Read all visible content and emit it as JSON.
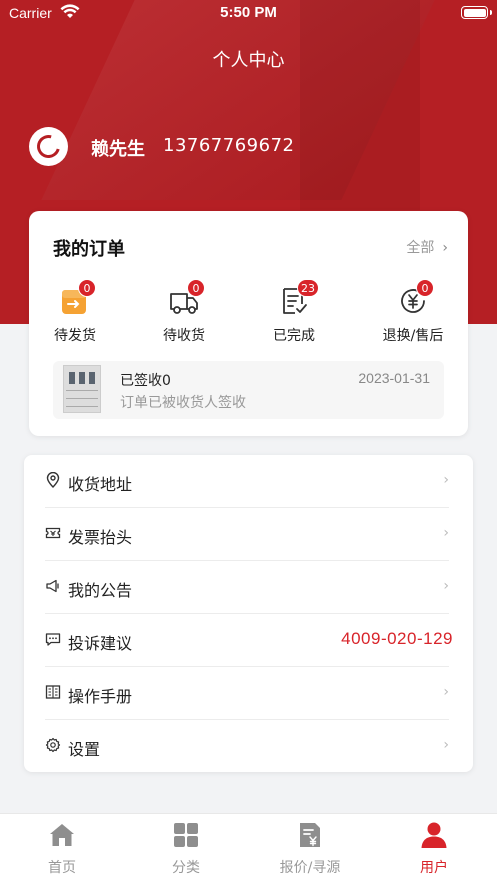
{
  "status_bar": {
    "carrier": "Carrier",
    "time": "5:50 PM"
  },
  "header": {
    "title": "个人中心"
  },
  "user": {
    "name": "赖先生",
    "phone": "13767769672"
  },
  "orders": {
    "title": "我的订单",
    "all_label": "全部",
    "statuses": [
      {
        "label": "待发货",
        "count": "0",
        "icon": "box-arrow-icon"
      },
      {
        "label": "待收货",
        "count": "0",
        "icon": "truck-icon"
      },
      {
        "label": "已完成",
        "count": "23",
        "icon": "document-check-icon"
      },
      {
        "label": "退换/售后",
        "count": "0",
        "icon": "refund-yen-icon"
      }
    ],
    "latest": {
      "status": "已签收0",
      "description": "订单已被收货人签收",
      "date": "2023-01-31"
    }
  },
  "menu": {
    "items": [
      {
        "label": "收货地址",
        "icon": "location-pin-icon"
      },
      {
        "label": "发票抬头",
        "icon": "invoice-icon"
      },
      {
        "label": "我的公告",
        "icon": "megaphone-icon"
      },
      {
        "label": "投诉建议",
        "icon": "message-icon",
        "phone": "4009-020-129"
      },
      {
        "label": "操作手册",
        "icon": "book-icon"
      },
      {
        "label": "设置",
        "icon": "gear-icon"
      }
    ]
  },
  "tabbar": {
    "tabs": [
      {
        "label": "首页",
        "icon": "home-icon"
      },
      {
        "label": "分类",
        "icon": "grid-icon"
      },
      {
        "label": "报价/寻源",
        "icon": "quote-icon"
      },
      {
        "label": "用户",
        "icon": "user-icon",
        "active": true
      }
    ]
  },
  "colors": {
    "brand": "#b51f24",
    "accent": "#d8242a"
  }
}
